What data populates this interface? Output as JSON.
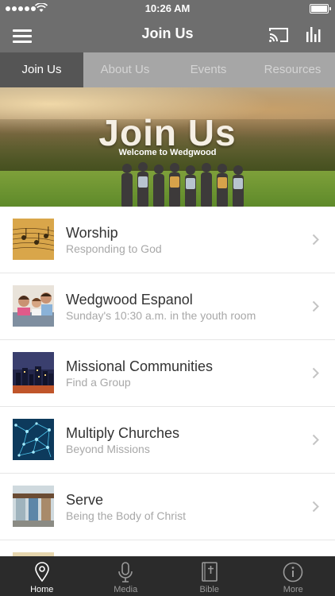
{
  "status": {
    "time": "10:26 AM"
  },
  "nav": {
    "title": "Join Us"
  },
  "tabs": [
    {
      "label": "Join Us",
      "active": true
    },
    {
      "label": "About Us",
      "active": false
    },
    {
      "label": "Events",
      "active": false
    },
    {
      "label": "Resources",
      "active": false
    }
  ],
  "hero": {
    "title": "Join Us",
    "subtitle": "Welcome to Wedgwood"
  },
  "items": [
    {
      "title": "Worship",
      "subtitle": "Responding to God",
      "thumb": "sheet-music"
    },
    {
      "title": "Wedgwood Espanol",
      "subtitle": "Sunday's 10:30 a.m. in the youth room",
      "thumb": "family"
    },
    {
      "title": "Missional Communities",
      "subtitle": "Find a Group",
      "thumb": "city-night"
    },
    {
      "title": "Multiply Churches",
      "subtitle": "Beyond Missions",
      "thumb": "network"
    },
    {
      "title": "Serve",
      "subtitle": "Being the Body of Christ",
      "thumb": "building"
    }
  ],
  "tabbar": [
    {
      "label": "Home",
      "icon": "location-pin-icon",
      "active": true
    },
    {
      "label": "Media",
      "icon": "microphone-icon",
      "active": false
    },
    {
      "label": "Bible",
      "icon": "bible-icon",
      "active": false
    },
    {
      "label": "More",
      "icon": "info-icon",
      "active": false
    }
  ],
  "colors": {
    "bar": "#6e6e6e",
    "tab_active": "#555555",
    "tabbar": "#2b2b2b"
  }
}
